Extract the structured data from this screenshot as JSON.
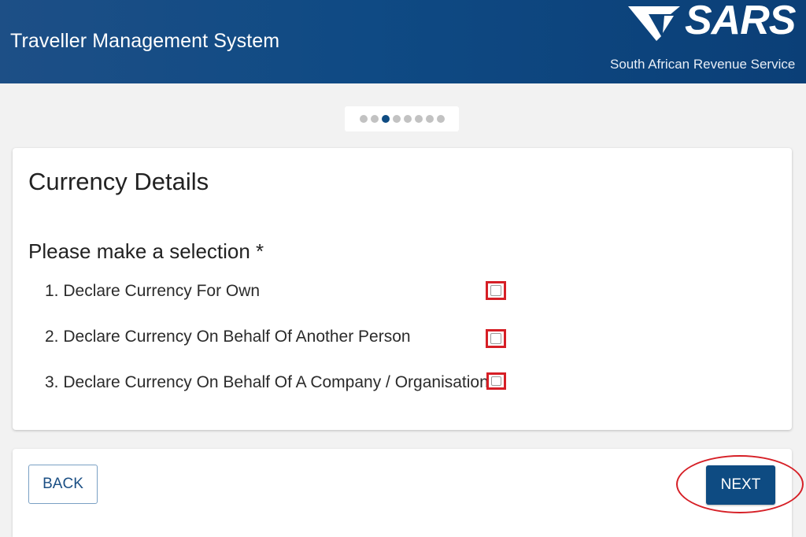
{
  "header": {
    "title": "Traveller Management System",
    "logo_text": "SARS",
    "org_name": "South African Revenue Service",
    "logo_icon": "sars-logo-icon"
  },
  "stepper": {
    "total_steps": 8,
    "current_step": 3
  },
  "form": {
    "section_title": "Currency Details",
    "prompt": "Please make a selection *",
    "options": [
      {
        "label": "1. Declare Currency For Own",
        "checked": false
      },
      {
        "label": "2. Declare Currency On Behalf Of Another Person",
        "checked": false
      },
      {
        "label": "3. Declare Currency On Behalf Of A Company / Organisation",
        "checked": false
      }
    ]
  },
  "footer": {
    "back_label": "BACK",
    "next_label": "NEXT"
  },
  "colors": {
    "brand_blue": "#0e4b82",
    "highlight_red": "#d61f26"
  }
}
